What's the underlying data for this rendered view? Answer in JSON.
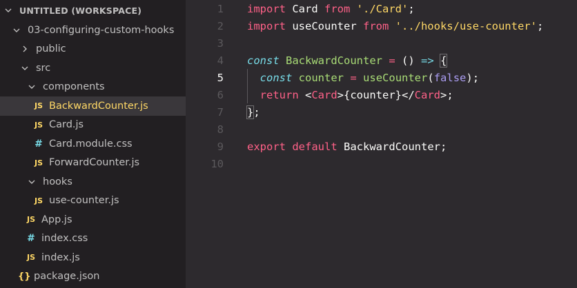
{
  "sidebar": {
    "workspace_title": "UNTITLED (WORKSPACE)",
    "items": [
      {
        "label": "03-configuring-custom-hooks"
      },
      {
        "label": "public"
      },
      {
        "label": "src"
      },
      {
        "label": "components"
      },
      {
        "label": "BackwardCounter.js"
      },
      {
        "label": "Card.js"
      },
      {
        "label": "Card.module.css"
      },
      {
        "label": "ForwardCounter.js"
      },
      {
        "label": "hooks"
      },
      {
        "label": "use-counter.js"
      },
      {
        "label": "App.js"
      },
      {
        "label": "index.css"
      },
      {
        "label": "index.js"
      },
      {
        "label": "package.json"
      }
    ],
    "badges": {
      "js": "JS",
      "css": "#",
      "json": "{}"
    }
  },
  "editor": {
    "line_numbers": [
      "1",
      "2",
      "3",
      "4",
      "5",
      "6",
      "7",
      "8",
      "9",
      "10"
    ],
    "current_line": "5",
    "tokens": {
      "l1": [
        "import",
        " Card ",
        "from",
        " './Card'",
        ";"
      ],
      "l2": [
        "import",
        " useCounter ",
        "from",
        " '../hooks/use-counter'",
        ";"
      ],
      "l4": [
        "const",
        " BackwardCounter ",
        "=",
        " () ",
        "=>",
        " ",
        "{"
      ],
      "l5": [
        "  ",
        "const",
        " counter ",
        "=",
        " ",
        "useCounter",
        "(",
        "false",
        ");"
      ],
      "l6": [
        "  ",
        "return",
        " <",
        "Card",
        ">{counter}</",
        "Card",
        ">;"
      ],
      "l7": [
        "}",
        ";"
      ],
      "l9": [
        "export",
        " ",
        "default",
        " BackwardCounter;"
      ]
    }
  }
}
